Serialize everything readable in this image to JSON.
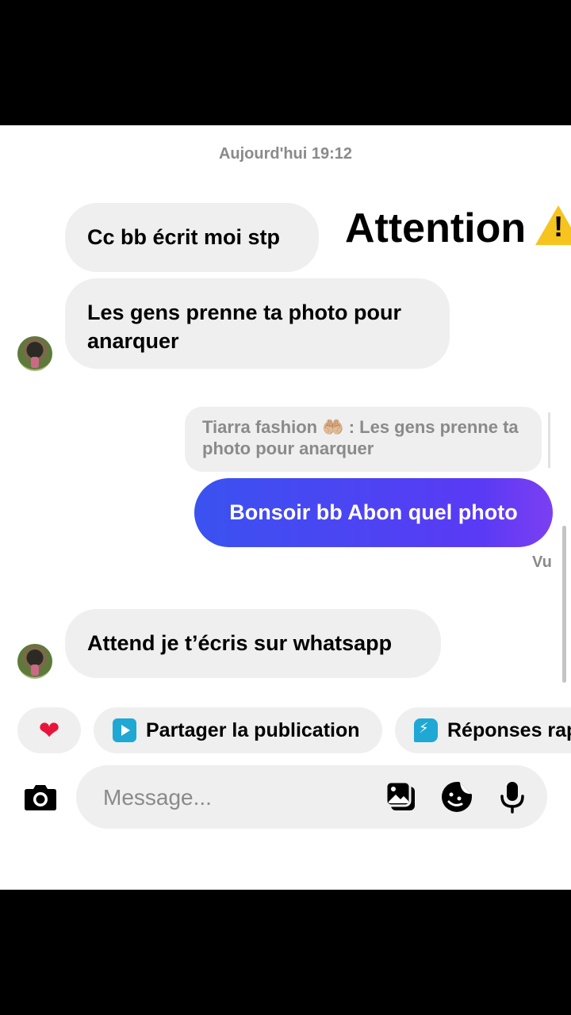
{
  "conversation": {
    "timestamp": "Aujourd'hui 19:12",
    "incoming_1": "Cc bb écrit moi stp",
    "incoming_2": "Les gens prenne ta photo pour anarquer",
    "reply_quote": "Tiarra fashion 🤲🏼 : Les gens prenne ta photo pour anarquer",
    "outgoing_1": "Bonsoir bb Abon quel photo",
    "seen_label": "Vu",
    "incoming_3": "Attend je t’écris sur whatsapp"
  },
  "overlay": {
    "caption": "Attention",
    "icon": "warning-icon"
  },
  "quick_actions": {
    "like_icon": "heart-icon",
    "share_label": "Partager la publication",
    "replies_label": "Réponses rapides"
  },
  "composer": {
    "placeholder": "Message..."
  },
  "colors": {
    "outgoing_gradient_start": "#3a52f0",
    "outgoing_gradient_end": "#7c3ff2",
    "incoming_bubble": "#efefef",
    "heart": "#e8143c",
    "warning": "#f7c31f"
  }
}
